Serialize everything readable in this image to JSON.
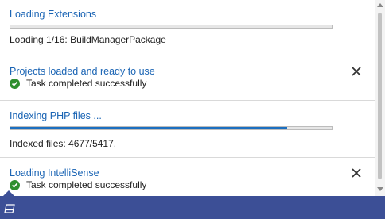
{
  "notifications": [
    {
      "title": "Loading Extensions",
      "status": "Loading 1/16: BuildManagerPackage",
      "progress": 0.0
    },
    {
      "title": "Projects loaded and ready to use",
      "status": "Task completed successfully"
    },
    {
      "title": "Indexing PHP files ...",
      "status": "Indexed files: 4677/5417.",
      "progress": 0.86
    },
    {
      "title": "Loading IntelliSense",
      "status": "Task completed successfully"
    }
  ],
  "colors": {
    "accent": "#1a64b4",
    "progress": "#1c6fc0",
    "success": "#2f8f2f",
    "statusbar": "#3c4f96"
  },
  "icons": {
    "close": "close-icon",
    "success": "check-circle-icon",
    "notifications": "notification-bell-icon"
  }
}
